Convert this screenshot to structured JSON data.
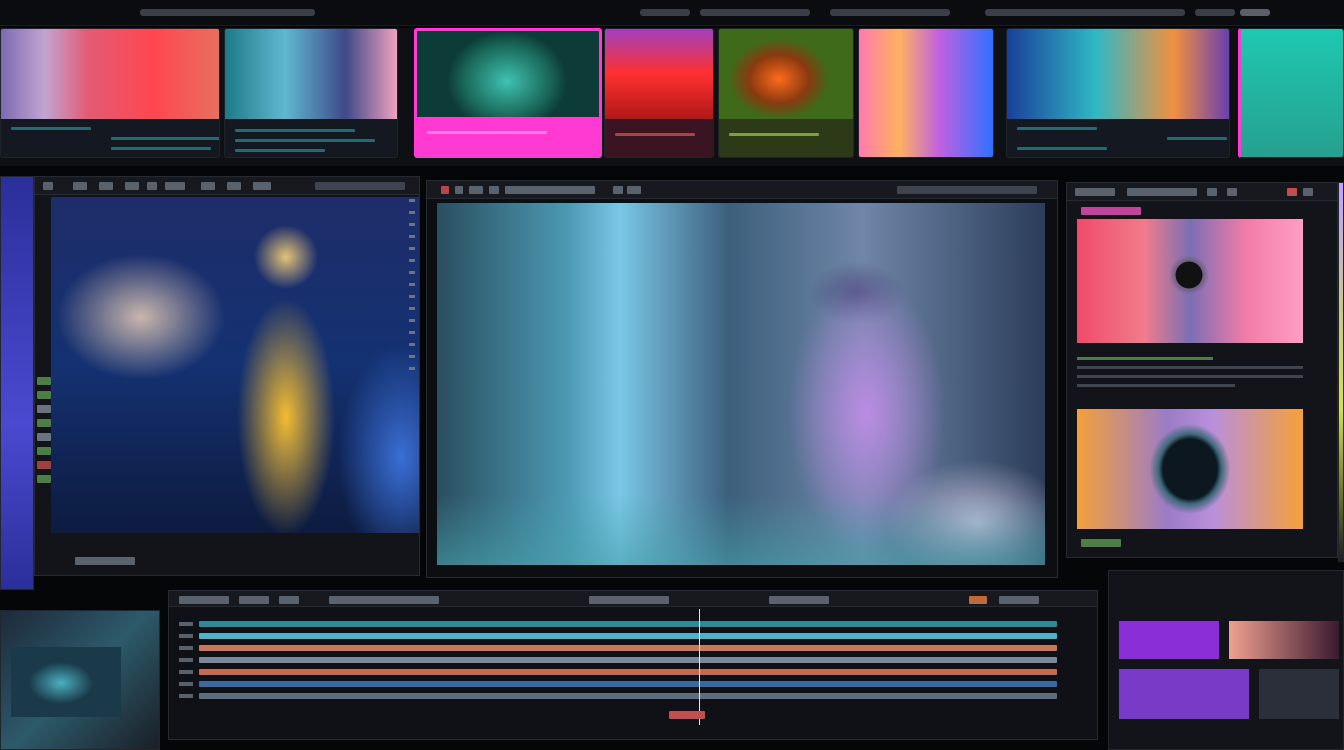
{
  "top_bar": {
    "dashes": 7
  },
  "thumbnail_strip": {
    "thumbnails": [
      {
        "name": "thumbnail-1"
      },
      {
        "name": "thumbnail-2"
      },
      {
        "name": "thumbnail-3"
      },
      {
        "name": "thumbnail-4"
      },
      {
        "name": "thumbnail-5"
      },
      {
        "name": "thumbnail-6"
      },
      {
        "name": "thumbnail-7"
      },
      {
        "name": "thumbnail-8"
      }
    ]
  },
  "left_preview": {
    "toolbar_glyphs": 10
  },
  "main_viewer": {
    "toolbar_glyphs": 8
  },
  "right_panel": {
    "toolbar_glyphs": 6
  },
  "timeline": {
    "tracks": [
      {
        "color": "#2f8a96"
      },
      {
        "color": "#4fb2c6"
      },
      {
        "color": "#c7795a"
      },
      {
        "color": "#7a8a9a"
      },
      {
        "color": "#c56a52"
      },
      {
        "color": "#3a6aa0"
      },
      {
        "color": "#5f6e7e"
      }
    ]
  },
  "colors": {
    "accent_magenta": "#ff3ad2",
    "accent_teal": "#2fb8c4",
    "accent_orange": "#e08a4a",
    "panel_bg": "#121419"
  }
}
